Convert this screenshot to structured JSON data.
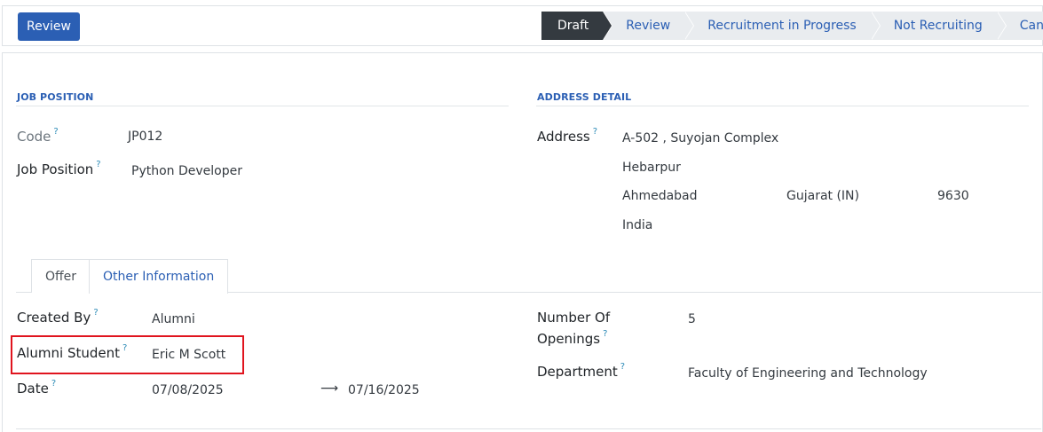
{
  "header": {
    "review_button": "Review",
    "stages": [
      {
        "label": "Draft",
        "active": true
      },
      {
        "label": "Review",
        "active": false
      },
      {
        "label": "Recruitment in Progress",
        "active": false
      },
      {
        "label": "Not Recruiting",
        "active": false
      },
      {
        "label": "Cancel",
        "active": false
      }
    ]
  },
  "job_position_section": {
    "title": "JOB POSITION",
    "code_label": "Code",
    "code_value": "JP012",
    "job_position_label": "Job Position",
    "job_position_value": "Python Developer"
  },
  "address_section": {
    "title": "ADDRESS DETAIL",
    "address_label": "Address",
    "street": "A-502 , Suyojan Complex",
    "street2": "Hebarpur",
    "city": "Ahmedabad",
    "state": "Gujarat (IN)",
    "zip": "9630",
    "country": "India"
  },
  "tabs": [
    {
      "label": "Offer",
      "active": false
    },
    {
      "label": "Other Information",
      "active": true
    }
  ],
  "other_information": {
    "created_by_label": "Created By",
    "created_by_value": "Alumni",
    "alumni_student_label": "Alumni Student",
    "alumni_student_value": "Eric M Scott",
    "date_label": "Date",
    "date_start": "07/08/2025",
    "date_end": "07/16/2025",
    "openings_label_line1": "Number Of",
    "openings_label_line2": "Openings",
    "openings_value": "5",
    "department_label": "Department",
    "department_value": "Faculty of Engineering and Technology"
  },
  "help_marker": "?",
  "colors": {
    "primary": "#2b5fb4",
    "active_stage": "#343a40",
    "highlight": "#e0141e"
  }
}
